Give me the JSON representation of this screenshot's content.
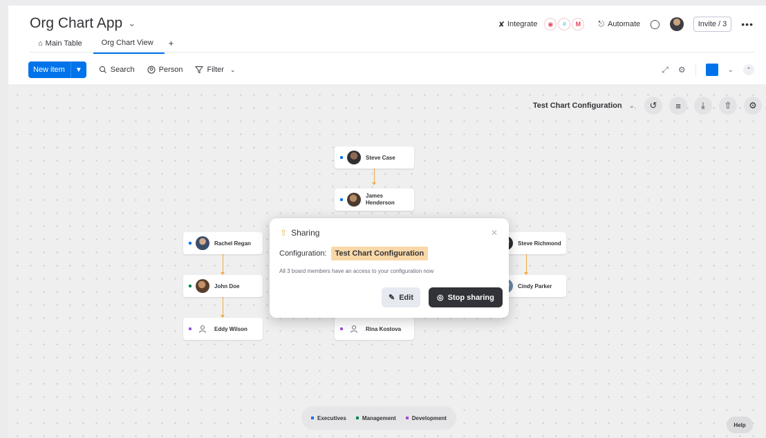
{
  "header": {
    "app_title": "Org Chart App",
    "tabs": [
      {
        "label": "Main Table"
      },
      {
        "label": "Org Chart View"
      }
    ],
    "add_tab": "+",
    "integrate_label": "Integrate",
    "automate_label": "Automate",
    "invite_label": "Invite / 3",
    "more_label": "•••"
  },
  "toolbar": {
    "new_item_label": "New item",
    "search_label": "Search",
    "person_label": "Person",
    "filter_label": "Filter"
  },
  "config_bar": {
    "name": "Test Chart Configuration"
  },
  "nodes": [
    {
      "name": "Steve Case",
      "group": "exec"
    },
    {
      "name": "James Henderson",
      "group": "exec"
    },
    {
      "name": "Rachel Regan",
      "group": "exec"
    },
    {
      "name": "John Doe",
      "group": "mgmt"
    },
    {
      "name": "Eddy Wilson",
      "group": "dev"
    },
    {
      "name": "Rina Kostova",
      "group": "dev"
    },
    {
      "name": "Steve Richmond",
      "group": "exec"
    },
    {
      "name": "Cindy Parker",
      "group": "mgmt"
    }
  ],
  "modal": {
    "title": "Sharing",
    "config_label": "Configuration:",
    "config_value": "Test Chart Configuration",
    "note": "All 3 board members have an access to your configuration now",
    "edit_label": "Edit",
    "stop_label": "Stop sharing"
  },
  "legend": {
    "items": [
      {
        "label": "Executives",
        "color": "#0073ea"
      },
      {
        "label": "Management",
        "color": "#00854d"
      },
      {
        "label": "Development",
        "color": "#9d50dd"
      }
    ]
  },
  "help_label": "Help",
  "colors": {
    "accent": "#0073ea",
    "connector": "#f0a93d",
    "config_tag": "#f9d8a8"
  }
}
